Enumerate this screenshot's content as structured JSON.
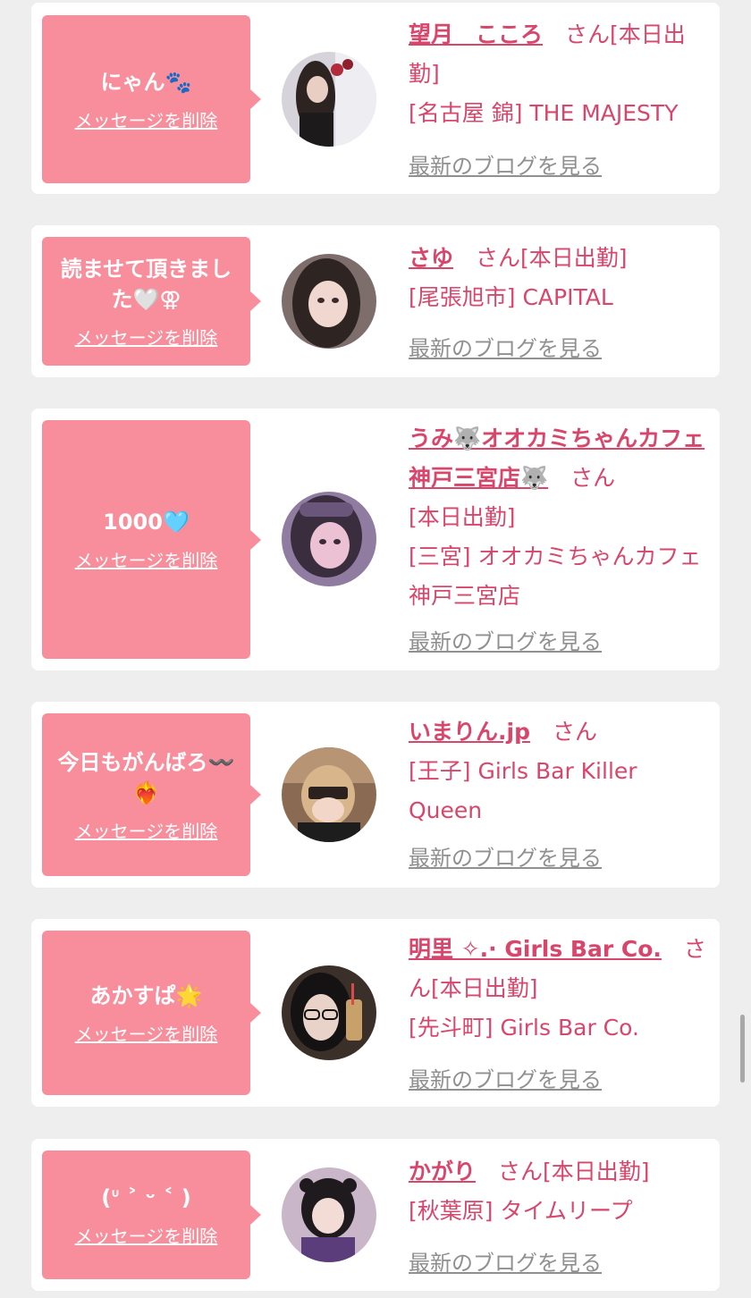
{
  "delete_label": "メッセージを削除",
  "blog_label": "最新のブログを見る",
  "colors": {
    "bubble": "#f88e9c",
    "accent": "#d8466b",
    "link_gray": "#909090",
    "background": "#eeeeee"
  },
  "items": [
    {
      "message": "にゃん🐾",
      "name": "望月　こころ",
      "suffix": "さん",
      "status": "[本日出勤]",
      "shop": "[名古屋 錦] THE MAJESTY"
    },
    {
      "message": "読ませて頂きました🤍⚢",
      "name": "さゆ",
      "suffix": "さん",
      "status": "[本日出勤]",
      "shop": "[尾張旭市] CAPITAL"
    },
    {
      "message": "1000🩵",
      "name": "うみ🐺オオカミちゃんカフェ神戸三宮店🐺",
      "suffix": "さん",
      "status": "[本日出勤]",
      "shop": "[三宮] オオカミちゃんカフェ神戸三宮店"
    },
    {
      "message": "今日もがんばろ〰️❤️‍🔥",
      "name": "いまりん.jp",
      "suffix": "さん",
      "status": "",
      "shop": "[王子] Girls Bar Killer Queen"
    },
    {
      "message": "あかすぱ🌟",
      "name": "明里 ✧.· Girls Bar Co.",
      "suffix": "さん",
      "status": "[本日出勤]",
      "shop": "[先斗町] Girls Bar Co."
    },
    {
      "message": "(ᐡ ˃ ᵕ ˂ )",
      "name": "かがり",
      "suffix": "さん",
      "status": "[本日出勤]",
      "shop": "[秋葉原] タイムリープ"
    }
  ]
}
